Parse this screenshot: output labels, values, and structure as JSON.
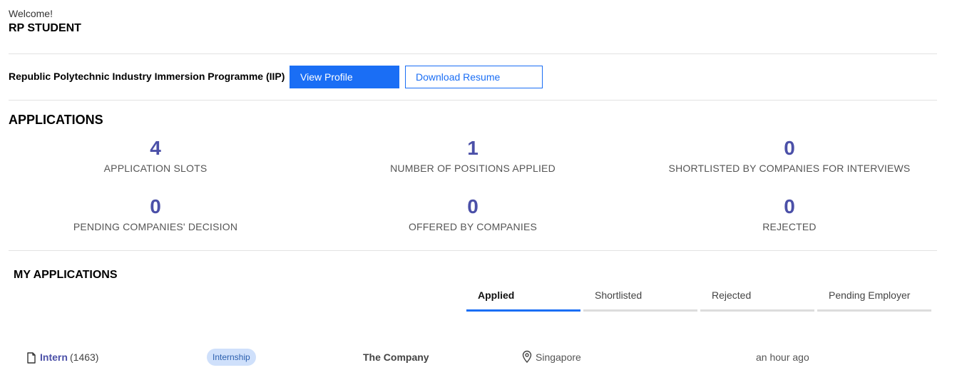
{
  "header": {
    "welcome": "Welcome!",
    "username": "RP STUDENT"
  },
  "profile": {
    "programme": "Republic Polytechnic Industry Immersion Programme (IIP)",
    "view_profile_label": "View Profile",
    "download_resume_label": "Download Resume"
  },
  "applications": {
    "title": "APPLICATIONS",
    "stats": [
      {
        "value": "4",
        "label": "APPLICATION SLOTS"
      },
      {
        "value": "1",
        "label": "NUMBER OF POSITIONS APPLIED"
      },
      {
        "value": "0",
        "label": "SHORTLISTED BY COMPANIES FOR INTERVIEWS"
      },
      {
        "value": "0",
        "label": "PENDING COMPANIES' DECISION"
      },
      {
        "value": "0",
        "label": "OFFERED BY COMPANIES"
      },
      {
        "value": "0",
        "label": "REJECTED"
      }
    ]
  },
  "my_applications": {
    "title": "MY APPLICATIONS",
    "tabs": [
      {
        "label": "Applied",
        "active": true
      },
      {
        "label": "Shortlisted",
        "active": false
      },
      {
        "label": "Rejected",
        "active": false
      },
      {
        "label": "Pending Employer",
        "active": false
      }
    ],
    "rows": [
      {
        "icon": "document-icon",
        "title": "Intern",
        "count": "(1463)",
        "type": "Internship",
        "company": "The Company",
        "location_icon": "location-pin-icon",
        "location": "Singapore",
        "time": "an hour ago"
      }
    ]
  },
  "colors": {
    "accent": "#1a6ef5",
    "stat_number": "#4b50a8",
    "badge_bg": "#cfe0fb"
  }
}
